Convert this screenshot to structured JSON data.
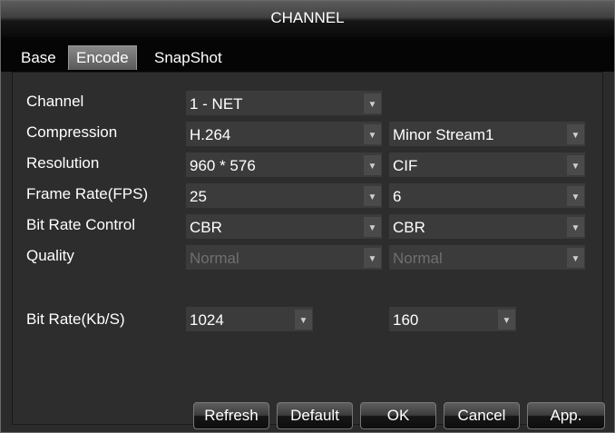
{
  "window": {
    "title": "CHANNEL"
  },
  "tabs": [
    {
      "label": "Base"
    },
    {
      "label": "Encode"
    },
    {
      "label": "SnapShot"
    }
  ],
  "form": {
    "channel": {
      "label": "Channel",
      "value": "1 - NET"
    },
    "compression": {
      "label": "Compression",
      "main": "H.264",
      "extra": "Minor Stream1"
    },
    "resolution": {
      "label": "Resolution",
      "main": "960 * 576",
      "extra": "CIF"
    },
    "frame_rate": {
      "label": "Frame Rate(FPS)",
      "main": "25",
      "extra": "6"
    },
    "bit_rate_control": {
      "label": "Bit Rate Control",
      "main": "CBR",
      "extra": "CBR"
    },
    "quality": {
      "label": "Quality",
      "main": "Normal",
      "extra": "Normal"
    },
    "bit_rate": {
      "label": "Bit Rate(Kb/S)",
      "main": "1024",
      "extra": "160"
    }
  },
  "buttons": {
    "refresh": "Refresh",
    "default": "Default",
    "ok": "OK",
    "cancel": "Cancel",
    "apply": "App."
  },
  "icons": {
    "dropdown_arrow": "▼"
  },
  "colors": {
    "background": "#2d2d2d",
    "text": "#ffffff",
    "disabled_text": "#6f6f6f",
    "field": "#3b3b3b"
  }
}
